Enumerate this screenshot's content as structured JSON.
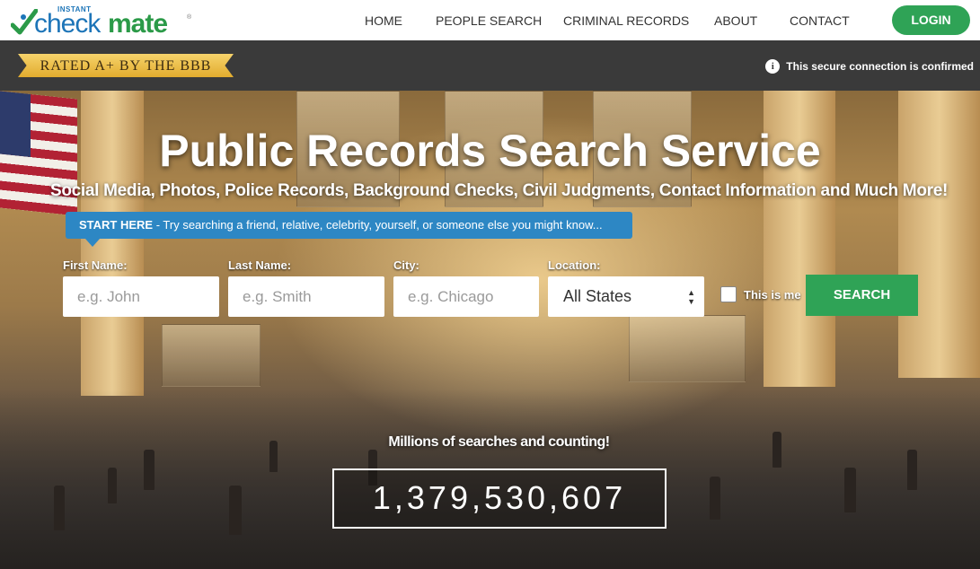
{
  "nav": {
    "logo": {
      "instant": "INSTANT",
      "check": "check",
      "mate": "mate",
      "reg": "®"
    },
    "links": [
      "HOME",
      "PEOPLE SEARCH",
      "CRIMINAL RECORDS",
      "ABOUT",
      "CONTACT"
    ],
    "login": "LOGIN",
    "brand_colors": {
      "blue": "#1d75b8",
      "green": "#2fa356"
    }
  },
  "bar": {
    "bbb_badge": "RATED A+ BY THE BBB",
    "info_icon": "i",
    "secure_text": "This secure connection is confirmed"
  },
  "hero": {
    "title": "Public Records Search Service",
    "subtitle": "Social Media, Photos, Police Records, Background Checks, Civil Judgments, Contact Information and Much More!",
    "start_here": {
      "label": "START HERE",
      "text": " - Try searching a friend, relative, celebrity, yourself, or someone else you might know..."
    },
    "form": {
      "first_name": {
        "label": "First Name:",
        "placeholder": "e.g. John",
        "value": ""
      },
      "last_name": {
        "label": "Last Name:",
        "placeholder": "e.g. Smith",
        "value": ""
      },
      "city": {
        "label": "City:",
        "placeholder": "e.g. Chicago",
        "value": ""
      },
      "location": {
        "label": "Location:",
        "selected": "All States"
      },
      "this_is_me": {
        "label": "This is me",
        "checked": false
      },
      "search_button": "SEARCH"
    },
    "counter": {
      "label": "Millions of searches and counting!",
      "value": "1,379,530,607"
    }
  }
}
